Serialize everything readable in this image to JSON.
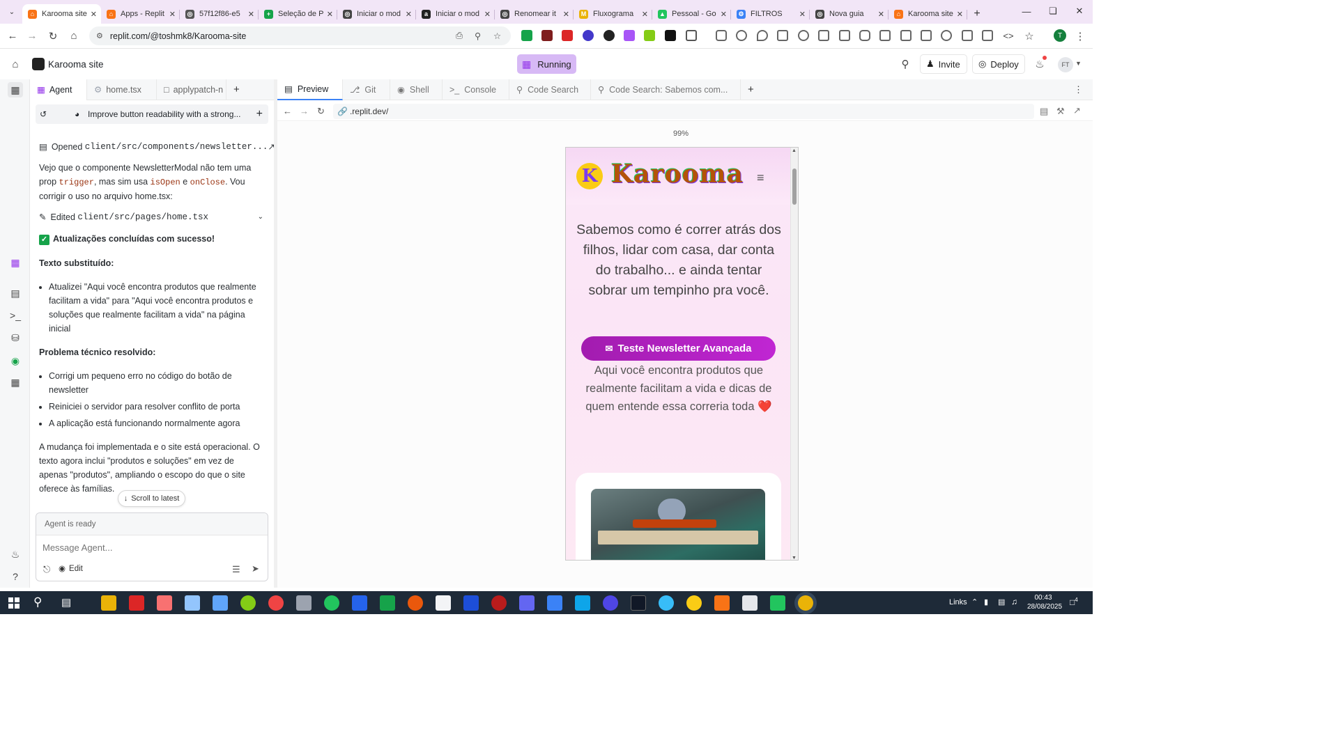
{
  "browser": {
    "tabs": [
      {
        "title": "Karooma site",
        "color": "#f97316",
        "glyph": "⌂",
        "active": true
      },
      {
        "title": "Apps - Replit",
        "color": "#f97316",
        "glyph": "⌂"
      },
      {
        "title": "57f12f86-e5",
        "color": "#555",
        "glyph": "◎"
      },
      {
        "title": "Seleção de P",
        "color": "#16a34a",
        "glyph": "+"
      },
      {
        "title": "Iniciar o mod",
        "color": "#444",
        "glyph": "◎"
      },
      {
        "title": "Iniciar o mod",
        "color": "#222",
        "glyph": "a"
      },
      {
        "title": "Renomear it",
        "color": "#444",
        "glyph": "◎"
      },
      {
        "title": "Fluxograma",
        "color": "#eab308",
        "glyph": "M"
      },
      {
        "title": "Pessoal - Go",
        "color": "#22c55e",
        "glyph": "▲"
      },
      {
        "title": "FILTROS",
        "color": "#3b82f6",
        "glyph": "⚙"
      },
      {
        "title": "Nova guia",
        "color": "#444",
        "glyph": "◎"
      },
      {
        "title": "Karooma site",
        "color": "#f97316",
        "glyph": "⌂"
      }
    ],
    "url": "replit.com/@toshmk8/Karooma-site"
  },
  "replit": {
    "project_name": "Karooma site",
    "run_label": "Running",
    "invite_label": "Invite",
    "deploy_label": "Deploy",
    "avatar_initials": "FT"
  },
  "agent_panel": {
    "tabs": [
      "Agent",
      "home.tsx",
      "applypatch-n"
    ],
    "thread_title": "Improve button readability with a strong...",
    "opened_prefix": "Opened",
    "opened_file": "client/src/components/newsletter...",
    "msg1_a": "Vejo que o componente NewsletterModal não tem uma prop",
    "code_trigger": "trigger",
    "msg1_b": ", mas sim usa",
    "code_isopen": "isOpen",
    "msg1_c": "e",
    "code_onclose": "onClose",
    "msg1_d": ". Vou corrigir o uso no arquivo home.tsx:",
    "edited_prefix": "Edited",
    "edited_file": "client/src/pages/home.tsx",
    "success": "Atualizações concluídas com sucesso!",
    "h_text": "Texto substituído:",
    "bullet_text": "Atualizei \"Aqui você encontra produtos que realmente facilitam a vida\" para \"Aqui você encontra produtos e soluções que realmente facilitam a vida\" na página inicial",
    "h_tech": "Problema técnico resolvido:",
    "tech_bullets": [
      "Corrigi um pequeno erro no código do botão de newsletter",
      "Reiniciei o servidor para resolver conflito de porta",
      "A aplicação está funcionando normalmente agora"
    ],
    "summary": "A mudança foi implementada e o site está operacional. O texto agora inclui \"produtos e soluções\" em vez de apenas \"produtos\", ampliando o escopo do que o site oferece às famílias.",
    "scroll_latest": "Scroll to latest",
    "status": "Agent is ready",
    "placeholder": "Message Agent...",
    "edit_label": "Edit"
  },
  "workspace": {
    "tabs": [
      "Preview",
      "Git",
      "Shell",
      "Console",
      "Code Search",
      "Code Search: Sabemos com..."
    ],
    "url": ".replit.dev/",
    "zoom": "99%"
  },
  "site": {
    "logo_letter": "K",
    "brand": "Karooma",
    "hero": "Sabemos como é correr atrás dos filhos, lidar com casa, dar conta do trabalho... e ainda tentar sobrar um tempinho pra você.",
    "cta": "Teste Newsletter Avançada",
    "sub": "Aqui você encontra produtos que realmente facilitam a vida e dicas de quem entende essa correria toda",
    "heart": "❤️"
  },
  "taskbar": {
    "links_label": "Links",
    "time": "00:43",
    "date": "28/08/2025",
    "notif_count": "4"
  }
}
